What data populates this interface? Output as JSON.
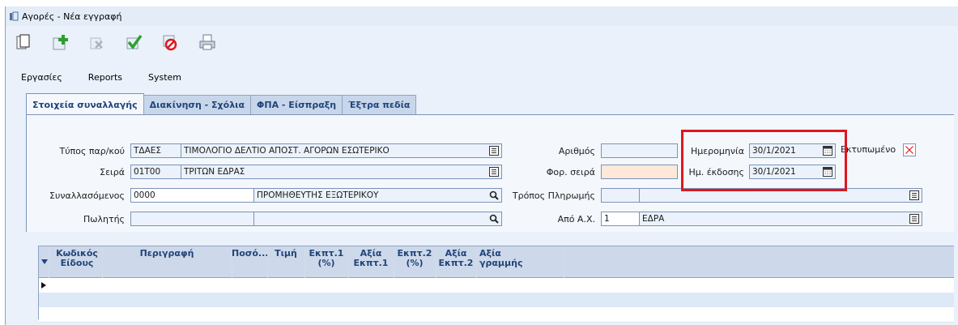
{
  "window": {
    "title": "Αγορές - Νέα εγγραφή"
  },
  "toolbar": {
    "buttons": [
      {
        "name": "copy-icon"
      },
      {
        "name": "add-icon"
      },
      {
        "name": "delete-icon"
      },
      {
        "name": "save-icon"
      },
      {
        "name": "cancel-icon"
      },
      {
        "name": "print-icon"
      }
    ]
  },
  "menu": {
    "items": [
      "Εργασίες",
      "Reports",
      "System"
    ]
  },
  "tabs": [
    "Στοιχεία συναλλαγής",
    "Διακίνηση - Σχόλια",
    "ΦΠΑ - Είσπραξη",
    "Έξτρα πεδία"
  ],
  "form": {
    "doc_type_label": "Τύπος παρ/κού",
    "doc_type_code": "ΤΔΑΕΣ",
    "doc_type_desc": "ΤΙΜΟΛΟΓΙΟ ΔΕΛΤΙΟ ΑΠΟΣΤ. ΑΓΟΡΩΝ ΕΣΩΤΕΡΙΚΟ",
    "series_label": "Σειρά",
    "series_code": "01Τ00",
    "series_desc": "ΤΡΙΤΩΝ ΕΔΡΑΣ",
    "partner_label": "Συναλλασόμενος",
    "partner_code": "0000",
    "partner_desc": "ΠΡΟΜΗΘΕΥΤΗΣ ΕΞΩΤΕΡΙΚΟΥ",
    "seller_label": "Πωλητής",
    "seller_value": "",
    "number_label": "Αριθμός",
    "number_value": "",
    "tax_series_label": "Φορ. σειρά",
    "tax_series_value": "",
    "payment_label": "Τρόπος Πληρωμής",
    "payment_code": "",
    "payment_desc": "",
    "from_ax_label": "Από Α.Χ.",
    "from_ax_code": "1",
    "from_ax_desc": "ΕΔΡΑ",
    "date_label": "Ημερομηνία",
    "date_value": "30/1/2021",
    "issue_date_label": "Ημ. έκδοσης",
    "issue_date_value": "30/1/2021",
    "printed_label": "Εκτυπωμένο",
    "printed_checked": true
  },
  "grid": {
    "columns": [
      {
        "top": "Κωδικός",
        "bottom": "Είδους"
      },
      {
        "top": "Περιγραφή",
        "bottom": ""
      },
      {
        "top": "Ποσό...",
        "bottom": ""
      },
      {
        "top": "Τιμή",
        "bottom": ""
      },
      {
        "top": "Εκπτ.1",
        "bottom": "(%)"
      },
      {
        "top": "Αξία",
        "bottom": "Εκπτ.1"
      },
      {
        "top": "Εκπτ.2",
        "bottom": "(%)"
      },
      {
        "top": "Αξία",
        "bottom": "Εκπτ.2"
      },
      {
        "top": "Αξία",
        "bottom": "γραμμής"
      }
    ]
  },
  "colors": {
    "highlight": "#e0161f",
    "tab_text": "#22447a",
    "panel_bg": "#f4f8fd"
  }
}
